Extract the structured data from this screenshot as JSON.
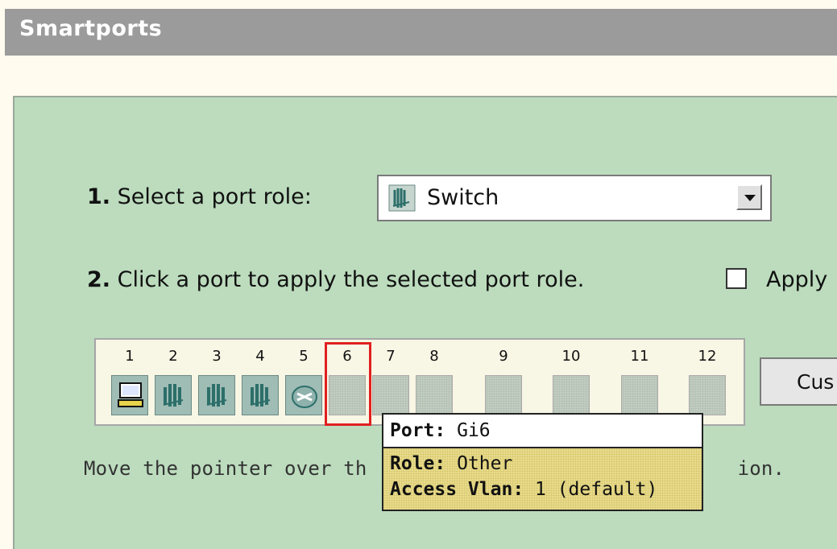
{
  "header": {
    "title": "Smartports"
  },
  "steps": {
    "step1_num": "1.",
    "step1_text": "Select a port role:",
    "step2_num": "2.",
    "step2_text": "Click a port to apply the selected port role.",
    "apply_label": "Apply"
  },
  "role_select": {
    "value": "Switch",
    "icon": "switch-icon"
  },
  "apply_checkbox": {
    "checked": false
  },
  "ports": [
    {
      "number": "1",
      "role_icon": "desktop-icon"
    },
    {
      "number": "2",
      "role_icon": "switch-icon"
    },
    {
      "number": "3",
      "role_icon": "switch-icon"
    },
    {
      "number": "4",
      "role_icon": "switch-icon"
    },
    {
      "number": "5",
      "role_icon": "router-icon"
    },
    {
      "number": "6",
      "role_icon": "none"
    },
    {
      "number": "7",
      "role_icon": "none"
    },
    {
      "number": "8",
      "role_icon": "none"
    },
    {
      "number": "9",
      "role_icon": "none"
    },
    {
      "number": "10",
      "role_icon": "none"
    },
    {
      "number": "11",
      "role_icon": "none"
    },
    {
      "number": "12",
      "role_icon": "none"
    }
  ],
  "customize_button": {
    "label": "Cus"
  },
  "hint": {
    "text": "Move the pointer over th",
    "text_tail": "ion."
  },
  "tooltip": {
    "port_label": "Port:",
    "port_value": " Gi6",
    "role_label": "Role:",
    "role_value": " Other",
    "vlan_label": "Access Vlan:",
    "vlan_value": " 1 (default)"
  },
  "colors": {
    "header_bg": "#9b9b9b",
    "panel_bg": "#bcdcbd",
    "highlight": "#e02020",
    "tooltip_bg": "#e8dc8c"
  }
}
